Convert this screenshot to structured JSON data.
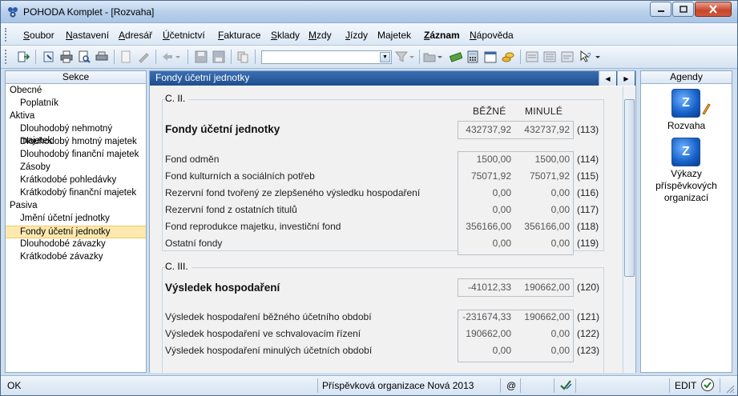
{
  "window": {
    "title": "POHODA Komplet - [Rozvaha]"
  },
  "menu": [
    {
      "label": "Soubor",
      "u": "S",
      "rest": "oubor",
      "bold": false
    },
    {
      "label": "Nastavení",
      "u": "N",
      "rest": "astavení",
      "bold": false
    },
    {
      "label": "Adresář",
      "u": "A",
      "rest": "dresář",
      "bold": false
    },
    {
      "label": "Účetnictví",
      "u": "Ú",
      "rest": "četnictví",
      "bold": false
    },
    {
      "label": "Fakturace",
      "u": "F",
      "rest": "akturace",
      "bold": false
    },
    {
      "label": "Sklady",
      "u": "S",
      "rest": "klady",
      "bold": false
    },
    {
      "label": "Mzdy",
      "u": "M",
      "rest": "zdy",
      "bold": false
    },
    {
      "label": "Jízdy",
      "u": "J",
      "rest": "ízdy",
      "bold": false
    },
    {
      "label": "Majetek",
      "u": "",
      "rest": "Majetek",
      "bold": false
    },
    {
      "label": "Záznam",
      "u": "Z",
      "rest": "áznam",
      "bold": true
    },
    {
      "label": "Nápověda",
      "u": "N",
      "rest": "ápověda",
      "bold": false
    }
  ],
  "sekce": {
    "title": "Sekce",
    "items": [
      {
        "label": "Obecné",
        "level": 0
      },
      {
        "label": "Poplatník",
        "level": 1
      },
      {
        "label": "Aktiva",
        "level": 0
      },
      {
        "label": "Dlouhodobý nehmotný majetek",
        "level": 1
      },
      {
        "label": "Dlouhodobý hmotný majetek",
        "level": 1
      },
      {
        "label": "Dlouhodobý finanční majetek",
        "level": 1
      },
      {
        "label": "Zásoby",
        "level": 1
      },
      {
        "label": "Krátkodobé pohledávky",
        "level": 1
      },
      {
        "label": "Krátkodobý finanční majetek",
        "level": 1
      },
      {
        "label": "Pasiva",
        "level": 0
      },
      {
        "label": "Jmění účetní jednotky",
        "level": 1
      },
      {
        "label": "Fondy účetní jednotky",
        "level": 1,
        "selected": true
      },
      {
        "label": "Dlouhodobé závazky",
        "level": 1
      },
      {
        "label": "Krátkodobé závazky",
        "level": 1
      }
    ]
  },
  "content": {
    "tab_title": "Fondy účetní jednotky",
    "col_current": "BĚŽNÉ",
    "col_previous": "MINULÉ",
    "group1": {
      "code": "C. II.",
      "total": {
        "label": "Fondy účetní jednotky",
        "current": "432737,92",
        "previous": "432737,92",
        "line": "(113)"
      },
      "rows": [
        {
          "label": "Fond odměn",
          "current": "1500,00",
          "previous": "1500,00",
          "line": "(114)"
        },
        {
          "label": "Fond kulturních a sociálních potřeb",
          "current": "75071,92",
          "previous": "75071,92",
          "line": "(115)"
        },
        {
          "label": "Rezervní fond tvořený ze zlepšeného výsledku hospodaření",
          "current": "0,00",
          "previous": "0,00",
          "line": "(116)"
        },
        {
          "label": "Rezervní fond z ostatních titulů",
          "current": "0,00",
          "previous": "0,00",
          "line": "(117)"
        },
        {
          "label": "Fond reprodukce majetku, investiční fond",
          "current": "356166,00",
          "previous": "356166,00",
          "line": "(118)"
        },
        {
          "label": "Ostatní fondy",
          "current": "0,00",
          "previous": "0,00",
          "line": "(119)"
        }
      ]
    },
    "group2": {
      "code": "C. III.",
      "total": {
        "label": "Výsledek hospodaření",
        "current": "-41012,33",
        "previous": "190662,00",
        "line": "(120)"
      },
      "rows": [
        {
          "label": "Výsledek hospodaření běžného účetního období",
          "current": "-231674,33",
          "previous": "190662,00",
          "line": "(121)"
        },
        {
          "label": "Výsledek hospodaření ve schvalovacím řízení",
          "current": "190662,00",
          "previous": "0,00",
          "line": "(122)"
        },
        {
          "label": "Výsledek hospodaření minulých účetních období",
          "current": "0,00",
          "previous": "0,00",
          "line": "(123)"
        }
      ]
    }
  },
  "agendy": {
    "title": "Agendy",
    "items": [
      {
        "label": "Rozvaha"
      },
      {
        "label_lines": [
          "Výkazy",
          "příspěvkových",
          "organizací"
        ]
      }
    ]
  },
  "status": {
    "left": "OK",
    "center": "Příspěvková organizace Nová 2013",
    "at": "@",
    "mode": "EDIT"
  },
  "colors": {
    "accent": "#1f4e8c",
    "selection": "#fde9b0",
    "frame": "#cfdfef"
  }
}
